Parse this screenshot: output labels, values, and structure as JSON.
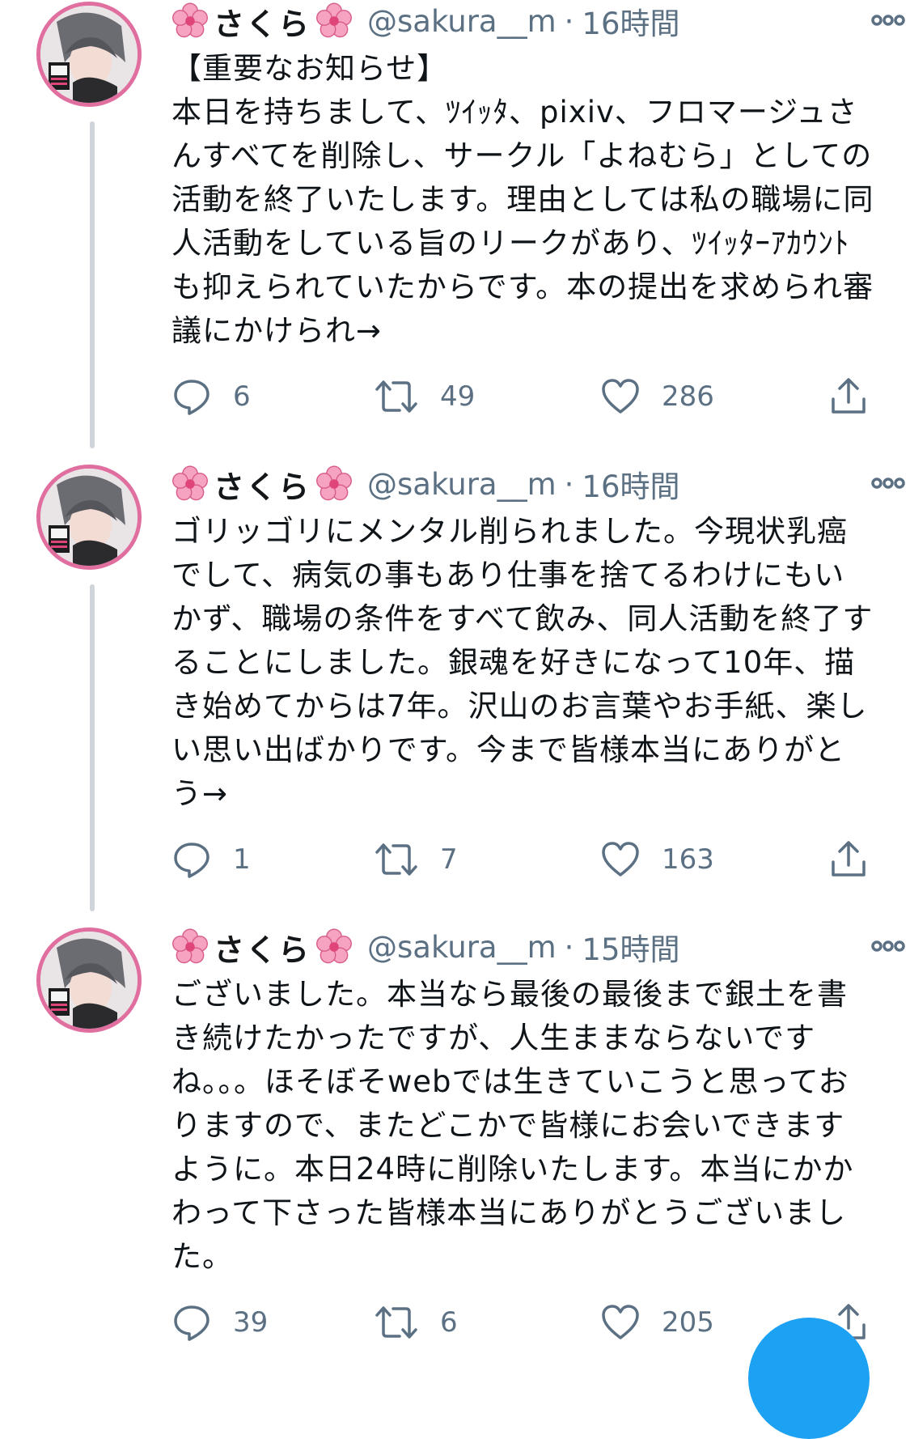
{
  "author": {
    "display_name": "さくら",
    "handle": "@sakura__m",
    "avatar": "avatar-image",
    "name_decoration_icon": "cherry-blossom-icon"
  },
  "separator": "·",
  "colors": {
    "avatar_border": "#e06fa0",
    "secondary_text": "#5b7083",
    "thread_line": "#cfd5da",
    "fab": "#1da1f2"
  },
  "icons": {
    "more": "more-options-icon",
    "reply": "reply-icon",
    "retweet": "retweet-icon",
    "like": "like-icon",
    "share": "share-icon"
  },
  "tweets": [
    {
      "timestamp": "16時間",
      "text": "【重要なお知らせ】\n本日を持ちまして、ﾂｲｯﾀ、pixiv、フロマージュさんすべてを削除し、サークル「よねむら」としての活動を終了いたします。理由としては私の職場に同人活動をしている旨のリークがあり、ﾂｲｯﾀｰｱｶｳﾝﾄも抑えられていたからです。本の提出を求められ審議にかけられ→",
      "replies": "6",
      "retweets": "49",
      "likes": "286"
    },
    {
      "timestamp": "16時間",
      "text": "ゴリッゴリにメンタル削られました。今現状乳癌でして、病気の事もあり仕事を捨てるわけにもいかず、職場の条件をすべて飲み、同人活動を終了することにしました。銀魂を好きになって10年、描き始めてからは7年。沢山のお言葉やお手紙、楽しい思い出ばかりです。今まで皆様本当にありがとう→",
      "replies": "1",
      "retweets": "7",
      "likes": "163"
    },
    {
      "timestamp": "15時間",
      "text": "ございました。本当なら最後の最後まで銀土を書き続けたかったですが、人生ままならないですね。。。ほそぼそwebでは生きていこうと思っておりますので、またどこかで皆様にお会いできますように。本日24時に削除いたします。本当にかかわって下さった皆様本当にありがとうございました。",
      "replies": "39",
      "retweets": "6",
      "likes": "205"
    }
  ]
}
